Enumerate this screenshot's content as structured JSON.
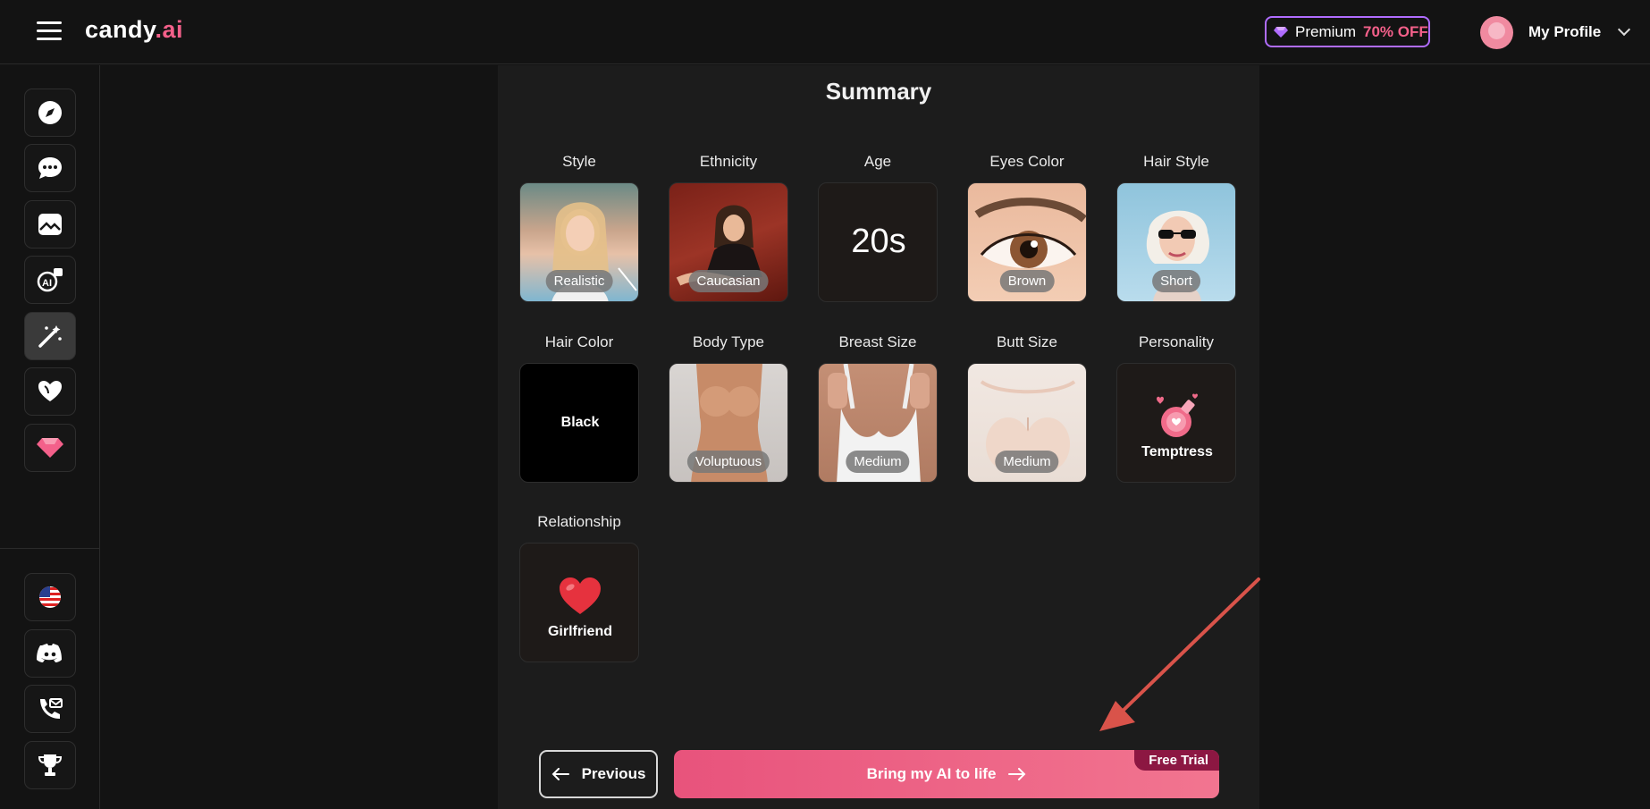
{
  "header": {
    "brand_name": "candy",
    "brand_suffix": ".ai",
    "premium_label": "Premium",
    "premium_discount": "70% OFF",
    "profile_label": "My Profile"
  },
  "sidebar": {
    "top_items": [
      {
        "icon": "compass-icon"
      },
      {
        "icon": "chat-icon"
      },
      {
        "icon": "gallery-icon"
      },
      {
        "icon": "ai-generate-icon"
      },
      {
        "icon": "magic-wand-icon",
        "active": true
      },
      {
        "icon": "heart-icon"
      },
      {
        "icon": "premium-gem-icon"
      }
    ],
    "bottom_items": [
      {
        "icon": "us-flag-icon"
      },
      {
        "icon": "discord-icon"
      },
      {
        "icon": "contact-icon"
      },
      {
        "icon": "trophy-icon"
      }
    ]
  },
  "summary": {
    "title": "Summary",
    "items": [
      {
        "label": "Style",
        "value": "Realistic"
      },
      {
        "label": "Ethnicity",
        "value": "Caucasian"
      },
      {
        "label": "Age",
        "value": "20s"
      },
      {
        "label": "Eyes Color",
        "value": "Brown"
      },
      {
        "label": "Hair Style",
        "value": "Short"
      },
      {
        "label": "Hair Color",
        "value": "Black"
      },
      {
        "label": "Body Type",
        "value": "Voluptuous"
      },
      {
        "label": "Breast Size",
        "value": "Medium"
      },
      {
        "label": "Butt Size",
        "value": "Medium"
      },
      {
        "label": "Personality",
        "value": "Temptress"
      },
      {
        "label": "Relationship",
        "value": "Girlfriend"
      }
    ]
  },
  "footer": {
    "previous_label": "Previous",
    "cta_label": "Bring my AI to life",
    "cta_badge": "Free Trial"
  },
  "colors": {
    "accent": "#f3608a",
    "premium_border": "#b06cff",
    "annotation_arrow": "#d9534a"
  }
}
